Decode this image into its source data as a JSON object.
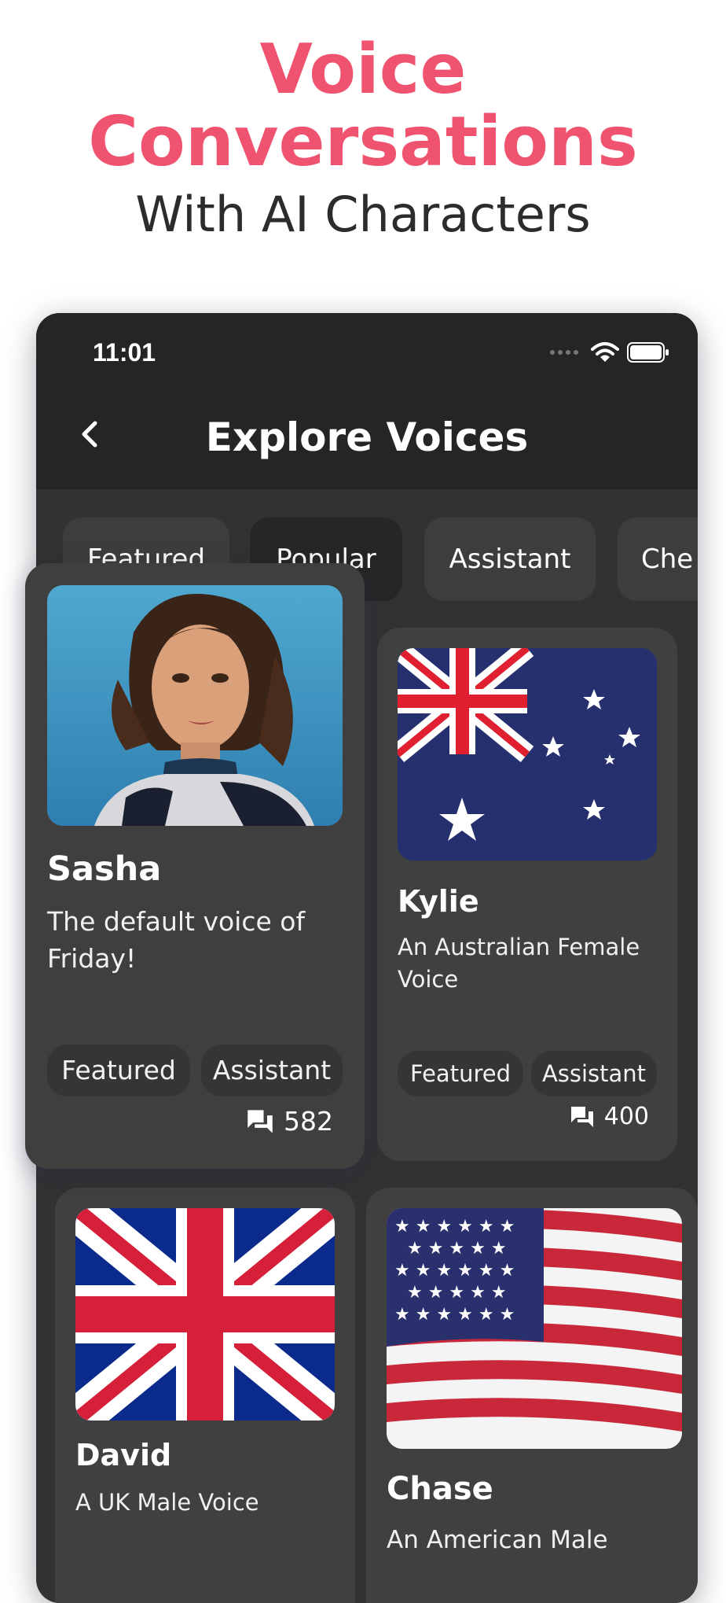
{
  "hero": {
    "title_line1": "Voice",
    "title_line2": "Conversations",
    "subtitle": "With AI Characters"
  },
  "status_bar": {
    "time": "11:01"
  },
  "header": {
    "title": "Explore Voices"
  },
  "categories": [
    {
      "label": "Featured"
    },
    {
      "label": "Popular"
    },
    {
      "label": "Assistant"
    },
    {
      "label": "Che"
    }
  ],
  "voices": [
    {
      "name": "Sasha",
      "description": "The default voice of Friday!",
      "tags": [
        "Featured",
        "Assistant"
      ],
      "count": "582"
    },
    {
      "name": "Kylie",
      "description": "An Australian Female Voice",
      "tags": [
        "Featured",
        "Assistant"
      ],
      "count": "400"
    },
    {
      "name": "David",
      "description": "A UK Male Voice",
      "tags": [],
      "count": ""
    },
    {
      "name": "Chase",
      "description": "An American Male",
      "tags": [],
      "count": ""
    }
  ],
  "colors": {
    "accent": "#f0536f",
    "card_bg": "#404040",
    "header_bg": "#252525"
  },
  "icons": [
    "back-chevron-icon",
    "wifi-icon",
    "battery-icon",
    "chat-bubbles-icon"
  ]
}
